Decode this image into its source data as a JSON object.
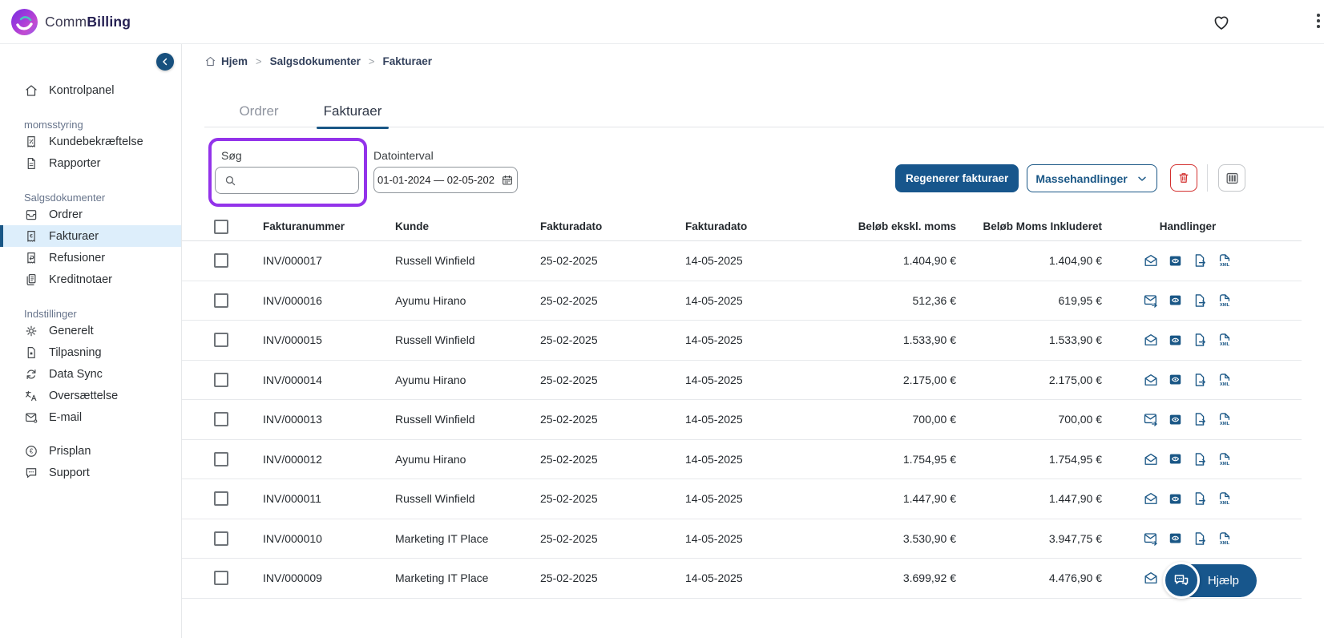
{
  "brand": {
    "name_regular": "Comm",
    "name_bold": "Billing",
    "logo_icon": "commbilling-swoosh"
  },
  "topbar": {
    "favorite_icon": "heart-outline",
    "overflow_icon": "kebab-menu"
  },
  "sidebar": {
    "collapse_icon": "chevron-left",
    "sections": [
      {
        "label": "",
        "items": [
          {
            "label": "Kontrolpanel",
            "icon": "home"
          }
        ]
      },
      {
        "label": "momsstyring",
        "items": [
          {
            "label": "Kundebekræftelse",
            "icon": "receipt-check"
          },
          {
            "label": "Rapporter",
            "icon": "report-document"
          }
        ]
      },
      {
        "label": "Salgsdokumenter",
        "items": [
          {
            "label": "Ordrer",
            "icon": "orders-tray"
          },
          {
            "label": "Fakturaer",
            "icon": "invoice-euro",
            "active": true
          },
          {
            "label": "Refusioner",
            "icon": "refund-receipt"
          },
          {
            "label": "Kreditnotaer",
            "icon": "credit-notes"
          }
        ]
      },
      {
        "label": "Indstillinger",
        "items": [
          {
            "label": "Generelt",
            "icon": "gear"
          },
          {
            "label": "Tilpasning",
            "icon": "customize-page"
          },
          {
            "label": "Data Sync",
            "icon": "sync-arrows"
          },
          {
            "label": "Oversættelse",
            "icon": "translate"
          },
          {
            "label": "E-mail",
            "icon": "email-gear"
          }
        ]
      },
      {
        "label": "",
        "items": [
          {
            "label": "Prisplan",
            "icon": "euro-circle"
          },
          {
            "label": "Support",
            "icon": "support-chat"
          }
        ]
      }
    ]
  },
  "breadcrumb": {
    "home_icon": "home",
    "items": [
      "Hjem",
      "Salgsdokumenter",
      "Fakturaer"
    ],
    "separator": ">"
  },
  "tabs": [
    {
      "label": "Ordrer",
      "active": false
    },
    {
      "label": "Fakturaer",
      "active": true
    }
  ],
  "filters": {
    "search": {
      "label": "Søg",
      "value": "",
      "icon": "magnifier"
    },
    "date_range": {
      "label": "Datointerval",
      "value": "01-01-2024 — 02-05-202",
      "icon": "calendar"
    }
  },
  "toolbar": {
    "regenerate_label": "Regenerer fakturaer",
    "bulk_actions_label": "Massehandlinger",
    "delete_icon": "trash",
    "columns_icon": "table-columns"
  },
  "table": {
    "columns": [
      "Fakturanummer",
      "Kunde",
      "Fakturadato",
      "Fakturadato",
      "Beløb ekskl. moms",
      "Beløb Moms Inkluderet",
      "Handlinger"
    ],
    "action_icons": [
      "mail",
      "view-invoice",
      "export-file",
      "export-xml"
    ],
    "rows": [
      {
        "invoice": "INV/000017",
        "customer": "Russell Winfield",
        "invoice_date": "25-02-2025",
        "due_date": "14-05-2025",
        "amount_excl": "1.404,90 €",
        "amount_incl": "1.404,90 €",
        "mail": "open"
      },
      {
        "invoice": "INV/000016",
        "customer": "Ayumu Hirano",
        "invoice_date": "25-02-2025",
        "due_date": "14-05-2025",
        "amount_excl": "512,36 €",
        "amount_incl": "619,95 €",
        "mail": "sent"
      },
      {
        "invoice": "INV/000015",
        "customer": "Russell Winfield",
        "invoice_date": "25-02-2025",
        "due_date": "14-05-2025",
        "amount_excl": "1.533,90 €",
        "amount_incl": "1.533,90 €",
        "mail": "open"
      },
      {
        "invoice": "INV/000014",
        "customer": "Ayumu Hirano",
        "invoice_date": "25-02-2025",
        "due_date": "14-05-2025",
        "amount_excl": "2.175,00 €",
        "amount_incl": "2.175,00 €",
        "mail": "open"
      },
      {
        "invoice": "INV/000013",
        "customer": "Russell Winfield",
        "invoice_date": "25-02-2025",
        "due_date": "14-05-2025",
        "amount_excl": "700,00 €",
        "amount_incl": "700,00 €",
        "mail": "sent"
      },
      {
        "invoice": "INV/000012",
        "customer": "Ayumu Hirano",
        "invoice_date": "25-02-2025",
        "due_date": "14-05-2025",
        "amount_excl": "1.754,95 €",
        "amount_incl": "1.754,95 €",
        "mail": "open"
      },
      {
        "invoice": "INV/000011",
        "customer": "Russell Winfield",
        "invoice_date": "25-02-2025",
        "due_date": "14-05-2025",
        "amount_excl": "1.447,90 €",
        "amount_incl": "1.447,90 €",
        "mail": "open"
      },
      {
        "invoice": "INV/000010",
        "customer": "Marketing IT Place",
        "invoice_date": "25-02-2025",
        "due_date": "14-05-2025",
        "amount_excl": "3.530,90 €",
        "amount_incl": "3.947,75 €",
        "mail": "sent"
      },
      {
        "invoice": "INV/000009",
        "customer": "Marketing IT Place",
        "invoice_date": "25-02-2025",
        "due_date": "14-05-2025",
        "amount_excl": "3.699,92 €",
        "amount_incl": "4.476,90 €",
        "mail": "open"
      }
    ]
  },
  "help": {
    "label": "Hjælp",
    "icon": "chat-bubbles"
  },
  "colors": {
    "primary_blue": "#1a5786",
    "button_navy": "#17568c",
    "highlight_purple": "#9333ea",
    "danger_red": "#d3302f",
    "selected_item_bg": "#ddeefb",
    "tab_underline": "#1a5786"
  }
}
